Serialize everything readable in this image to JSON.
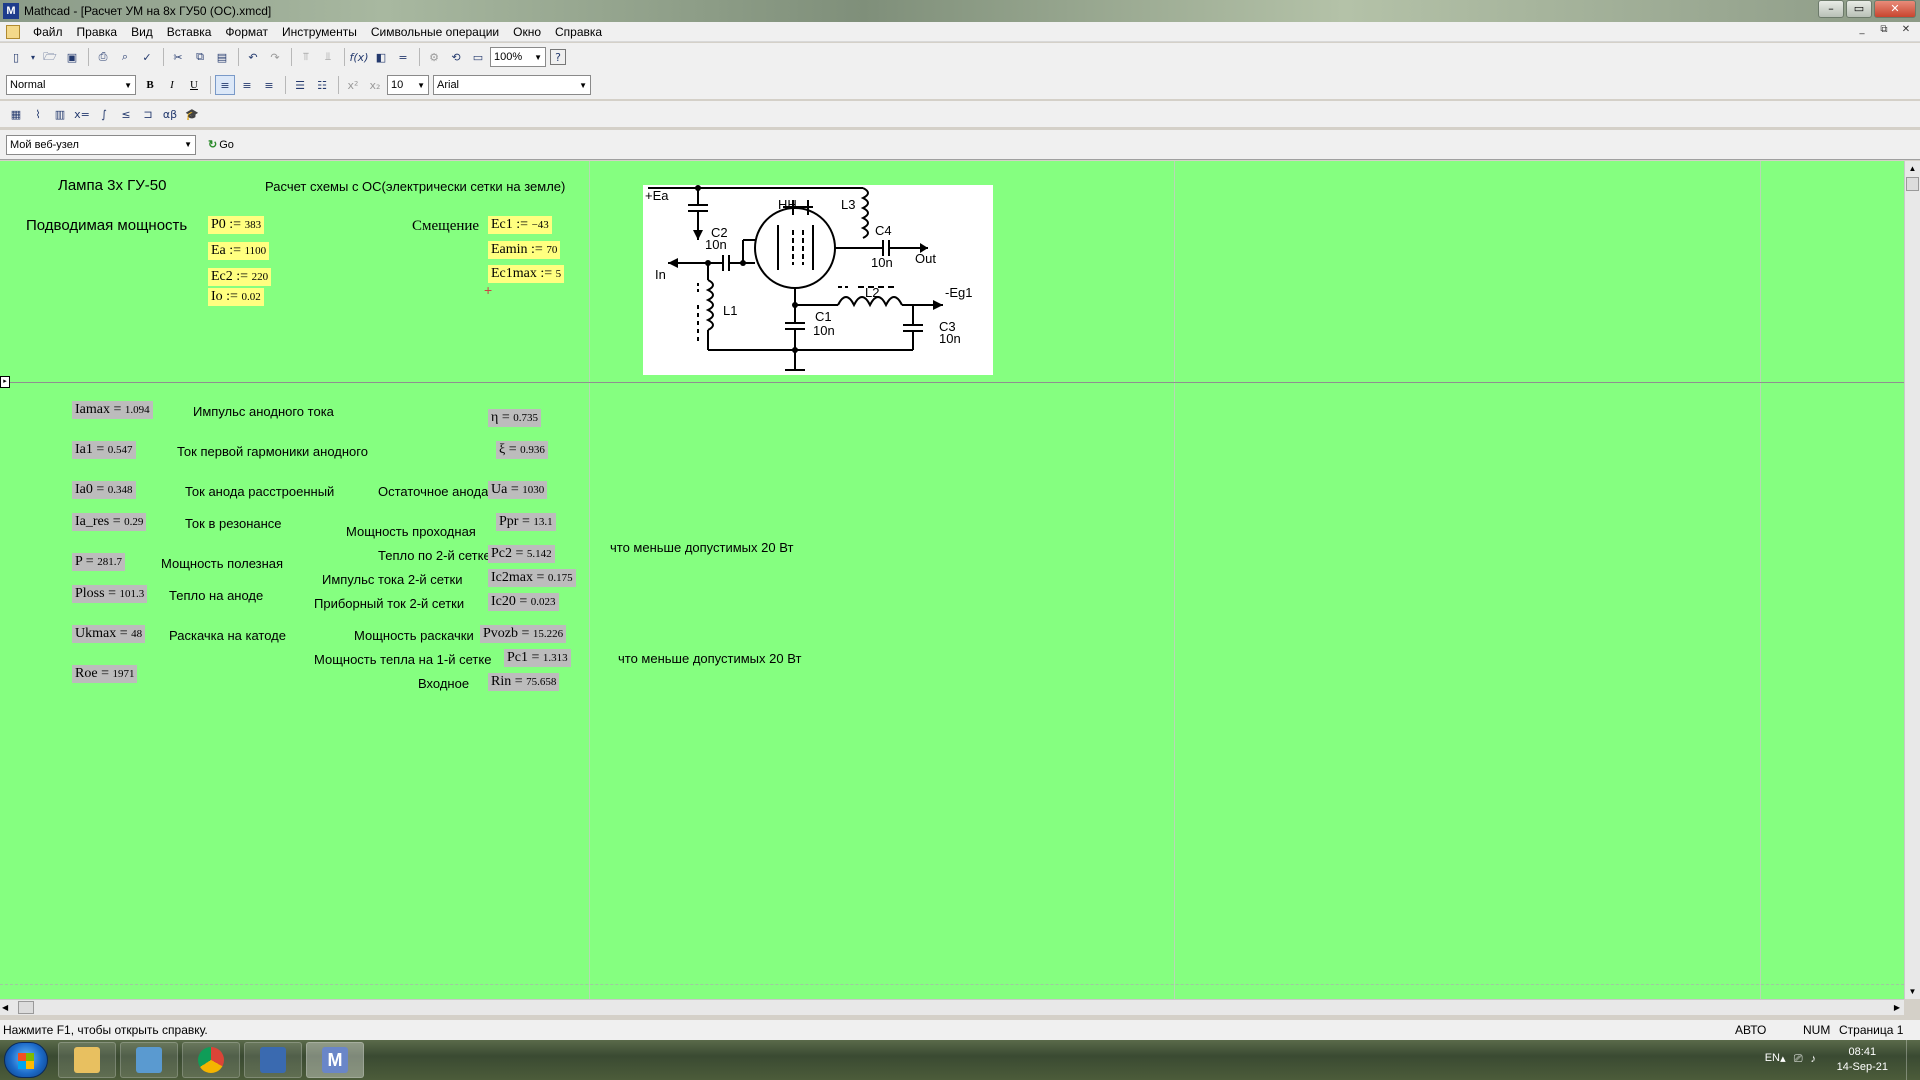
{
  "window": {
    "title": "Mathcad - [Расчет УМ на 8х ГУ50 (ОС).xmcd]",
    "app_icon": "M",
    "controls": [
      "–",
      "▭",
      "✕"
    ]
  },
  "menu": {
    "items": [
      "Файл",
      "Правка",
      "Вид",
      "Вставка",
      "Формат",
      "Инструменты",
      "Символьные операции",
      "Окно",
      "Справка"
    ],
    "mdi_controls": [
      "_",
      "⧉",
      "✕"
    ]
  },
  "toolbar": {
    "zoom": "100%",
    "style": "Normal",
    "font_size": "10",
    "font_name": "Arial",
    "web_node": "Мой веб-узел",
    "go_label": "Go",
    "bold": "B",
    "italic": "I",
    "underline": "U"
  },
  "sheet": {
    "header_lamp": "Лампа 3х ГУ-50",
    "header_scheme": "Расчет схемы с ОС(электрически сетки на земле)",
    "label_power": "Подводимая мощность",
    "label_bias": "Смещение",
    "inputs": [
      {
        "name": "P0",
        "op": ":=",
        "value": "383"
      },
      {
        "name": "Ea",
        "op": ":=",
        "value": "1100"
      },
      {
        "name": "Ec2",
        "op": ":=",
        "value": "220"
      },
      {
        "name": "Io",
        "op": ":=",
        "value": "0.02"
      },
      {
        "name": "Ec1",
        "op": ":=",
        "value": "−43"
      },
      {
        "name": "Eamin",
        "op": ":=",
        "value": "70"
      },
      {
        "name": "Ec1max",
        "op": ":=",
        "value": "5"
      }
    ],
    "results_left": [
      {
        "name": "Iamax",
        "value": "1.094",
        "label": "Импульс анодного тока"
      },
      {
        "name": "Ia1",
        "value": "0.547",
        "label": "Ток первой гармоники анодного"
      },
      {
        "name": "Ia0",
        "value": "0.348",
        "label": "Ток анода расстроенный"
      },
      {
        "name": "Ia_res",
        "value": "0.29",
        "label": "Ток в резонансе"
      },
      {
        "name": "P",
        "value": "281.7",
        "label": "Мощность полезная"
      },
      {
        "name": "Ploss",
        "value": "101.3",
        "label": "Тепло на аноде"
      },
      {
        "name": "Ukmax",
        "value": "48",
        "label": "Раскачка на катоде"
      },
      {
        "name": "Roe",
        "value": "1971",
        "label": ""
      }
    ],
    "results_right": [
      {
        "name": "η",
        "value": "0.735",
        "label": ""
      },
      {
        "name": "ξ",
        "value": "0.936",
        "label": ""
      },
      {
        "name": "Ua",
        "value": "1030",
        "label": "Остаточное анода"
      },
      {
        "name": "Ppr",
        "value": "13.1",
        "label": "Мощность проходная"
      },
      {
        "name": "Pc2",
        "value": "5.142",
        "label": "Тепло по 2-й сетке"
      },
      {
        "name": "Ic2max",
        "value": "0.175",
        "label": "Импульс тока 2-й сетки"
      },
      {
        "name": "Ic20",
        "value": "0.023",
        "label": "Приборный ток 2-й сетки"
      },
      {
        "name": "Pvozb",
        "value": "15.226",
        "label": "Мощность раскачки"
      },
      {
        "name": "Pc1",
        "value": "1.313",
        "label": "Мощность тепла на 1-й сетке"
      },
      {
        "name": "Rin",
        "value": "75.658",
        "label": "Входное"
      }
    ],
    "note_pc2": "что меньше допустимых 20 Вт",
    "note_pc1": "что меньше допустимых 20 Вт",
    "schematic_labels": {
      "ea": "+Ea",
      "c2": "C2",
      "c2v": "10n",
      "hh": "HH",
      "l3": "L3",
      "c4": "C4",
      "c4v": "10n",
      "out": "Out",
      "in": "In",
      "l2": "L2",
      "eg1": "-Eg1",
      "l1": "L1",
      "c1": "C1",
      "c1v": "10n",
      "c3": "C3",
      "c3v": "10n"
    }
  },
  "status": {
    "hint": "Нажмите F1, чтобы открыть справку.",
    "mode": "АВТО",
    "num": "NUM",
    "page": "Страница 1"
  },
  "taskbar": {
    "lang": "EN",
    "time": "08:41",
    "date": "14-Sep-21"
  },
  "colors": {
    "worksheet_bg": "#85ff80",
    "input_bg": "#ffff80",
    "result_bg": "#bcbcbc"
  }
}
